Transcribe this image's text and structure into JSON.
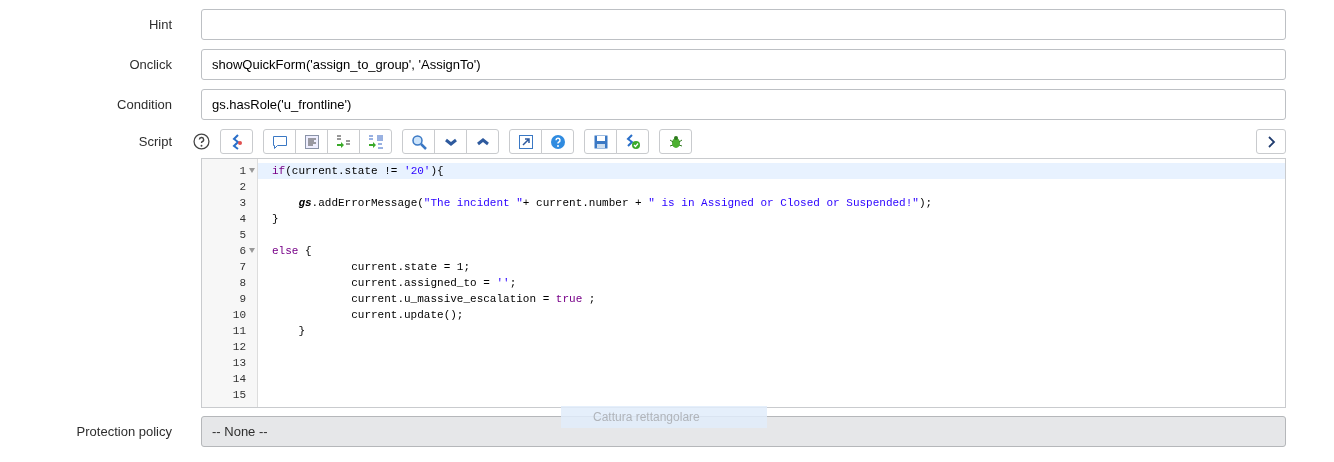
{
  "fields": [
    {
      "label": "Hint",
      "kind": "input"
    },
    {
      "label": "Onclick",
      "kind": "input",
      "value": "showQuickForm('assign_to_group', 'AssignTo')"
    },
    {
      "label": "Condition",
      "kind": "input",
      "value": "gs.hasRole('u_frontline')"
    }
  ],
  "script": {
    "label": "Script",
    "toolbar_groups": [
      {
        "buttons": [
          {
            "kind": "script-include"
          }
        ]
      },
      {
        "buttons": [
          {
            "kind": "comment"
          },
          {
            "kind": "format"
          },
          {
            "kind": "replace"
          },
          {
            "kind": "replace-all"
          }
        ]
      },
      {
        "buttons": [
          {
            "kind": "search"
          },
          {
            "kind": "next"
          },
          {
            "kind": "previous"
          }
        ]
      },
      {
        "buttons": [
          {
            "kind": "fullscreen"
          },
          {
            "kind": "help"
          }
        ]
      },
      {
        "buttons": [
          {
            "kind": "save"
          },
          {
            "kind": "validate"
          }
        ]
      },
      {
        "buttons": [
          {
            "kind": "debug"
          }
        ]
      }
    ],
    "lines": [
      {
        "number": "1",
        "fold": true,
        "highlighted": true,
        "tokens": [
          {
            "kind": "keyword",
            "text": "if"
          },
          {
            "kind": "plain",
            "text": "(current.state != "
          },
          {
            "kind": "string",
            "text": "'20'"
          },
          {
            "kind": "plain",
            "text": "){"
          }
        ]
      },
      {
        "number": "2",
        "fold": false,
        "highlighted": false
      },
      {
        "number": "3",
        "fold": false,
        "highlighted": false,
        "tokens": [
          {
            "kind": "global",
            "text": "    gs"
          },
          {
            "kind": "plain",
            "text": ".addErrorMessage("
          },
          {
            "kind": "string",
            "text": "\"The incident \""
          },
          {
            "kind": "plain",
            "text": "+ current.number + "
          },
          {
            "kind": "string",
            "text": "\" is in Assigned or Closed or Suspended!\""
          },
          {
            "kind": "plain",
            "text": ");"
          }
        ]
      },
      {
        "number": "4",
        "fold": false,
        "highlighted": false,
        "tokens": [
          {
            "kind": "plain",
            "text": "}"
          }
        ]
      },
      {
        "number": "5",
        "fold": false,
        "highlighted": false
      },
      {
        "number": "6",
        "fold": true,
        "highlighted": false,
        "tokens": [
          {
            "kind": "keyword",
            "text": "else"
          },
          {
            "kind": "plain",
            "text": " {"
          }
        ]
      },
      {
        "number": "7",
        "fold": false,
        "highlighted": false,
        "tokens": [
          {
            "kind": "plain",
            "text": "            current.state = 1;"
          }
        ]
      },
      {
        "number": "8",
        "fold": false,
        "highlighted": false,
        "tokens": [
          {
            "kind": "plain",
            "text": "            current.assigned_to = "
          },
          {
            "kind": "string",
            "text": "''"
          },
          {
            "kind": "plain",
            "text": ";"
          }
        ]
      },
      {
        "number": "9",
        "fold": false,
        "highlighted": false,
        "tokens": [
          {
            "kind": "plain",
            "text": "            current.u_massive_escalation = "
          },
          {
            "kind": "keyword",
            "text": "true"
          },
          {
            "kind": "plain",
            "text": " ;"
          }
        ]
      },
      {
        "number": "10",
        "fold": false,
        "highlighted": false,
        "tokens": [
          {
            "kind": "plain",
            "text": "            current.update();"
          }
        ]
      },
      {
        "number": "11",
        "fold": false,
        "highlighted": false,
        "tokens": [
          {
            "kind": "plain",
            "text": "    }"
          }
        ]
      },
      {
        "number": "12",
        "fold": false,
        "highlighted": false
      },
      {
        "number": "13",
        "fold": false,
        "highlighted": false
      },
      {
        "number": "14",
        "fold": false,
        "highlighted": false
      },
      {
        "number": "15",
        "fold": false,
        "highlighted": false
      }
    ]
  },
  "protection_policy": {
    "label": "Protection policy",
    "value": "-- None --",
    "disabled": true
  },
  "tooltip": {
    "text": "Cattura rettangolare"
  }
}
